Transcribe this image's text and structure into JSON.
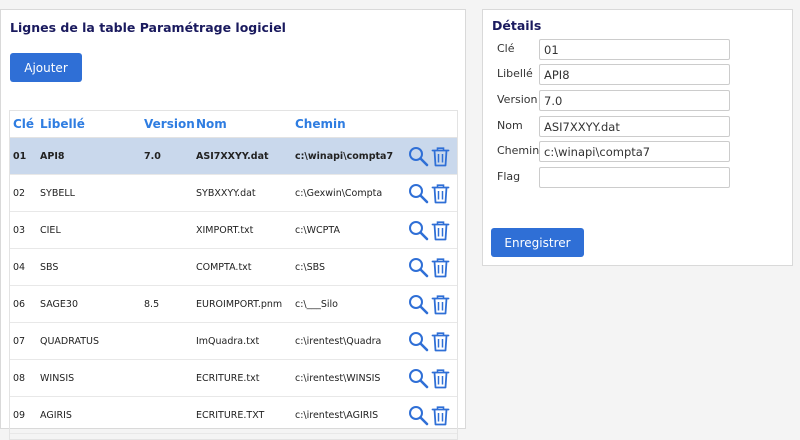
{
  "left_panel": {
    "title": "Lignes de la table Paramétrage logiciel",
    "add_label": "Ajouter",
    "columns": [
      "Clé",
      "Libellé",
      "Version",
      "Nom",
      "Chemin"
    ],
    "rows": [
      {
        "cle": "01",
        "libelle": "API8",
        "version": "7.0",
        "nom": "ASI7XXYY.dat",
        "chemin": "c:\\winapi\\compta7",
        "selected": true
      },
      {
        "cle": "02",
        "libelle": "SYBELL",
        "version": "",
        "nom": "SYBXXYY.dat",
        "chemin": "c:\\Gexwin\\Compta"
      },
      {
        "cle": "03",
        "libelle": "CIEL",
        "version": "",
        "nom": "XIMPORT.txt",
        "chemin": "c:\\WCPTA"
      },
      {
        "cle": "04",
        "libelle": "SBS",
        "version": "",
        "nom": "COMPTA.txt",
        "chemin": "c:\\SBS"
      },
      {
        "cle": "06",
        "libelle": "SAGE30",
        "version": "8.5",
        "nom": "EUROIMPORT.pnm",
        "chemin": "c:\\___Silo"
      },
      {
        "cle": "07",
        "libelle": "QUADRATUS",
        "version": "",
        "nom": "ImQuadra.txt",
        "chemin": "c:\\irentest\\Quadra"
      },
      {
        "cle": "08",
        "libelle": "WINSIS",
        "version": "",
        "nom": "ECRITURE.txt",
        "chemin": "c:\\irentest\\WINSIS"
      },
      {
        "cle": "09",
        "libelle": "AGIRIS",
        "version": "",
        "nom": "ECRITURE.TXT",
        "chemin": "c:\\irentest\\AGIRIS"
      }
    ]
  },
  "right_panel": {
    "title": "Détails",
    "fields": [
      {
        "label": "Clé",
        "value": "01"
      },
      {
        "label": "Libellé",
        "value": "API8"
      },
      {
        "label": "Version",
        "value": "7.0"
      },
      {
        "label": "Nom",
        "value": "ASI7XXYY.dat"
      },
      {
        "label": "Chemin",
        "value": "c:\\winapi\\compta7"
      },
      {
        "label": "Flag",
        "value": ""
      }
    ],
    "save_label": "Enregistrer"
  },
  "colors": {
    "accent": "#2f6fd6",
    "header_text": "#2f7de1",
    "selected_row": "#c9d8ec",
    "title": "#1a1a5e"
  },
  "icons": [
    "search-icon",
    "trash-icon"
  ]
}
